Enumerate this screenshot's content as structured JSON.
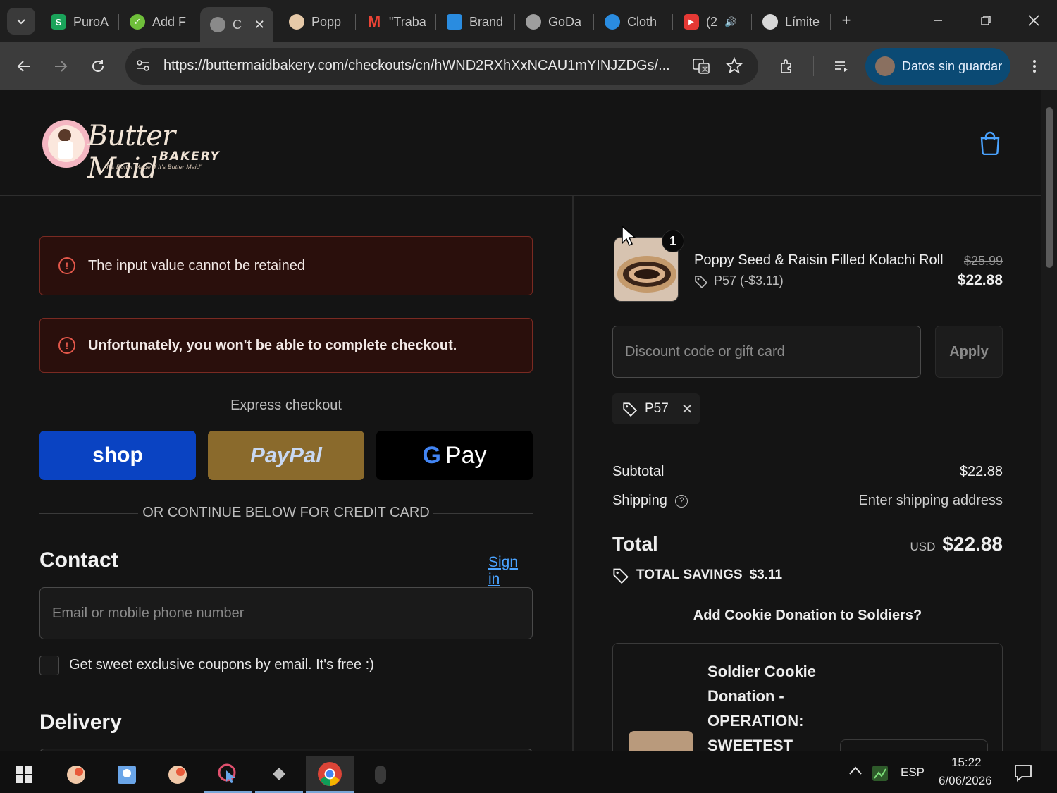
{
  "browser": {
    "tabs": [
      {
        "label": "PuroA",
        "favicon_color": "#1aa35a",
        "favicon_letter": "S"
      },
      {
        "label": "Add F",
        "favicon_color": "#6fbf3a",
        "favicon_letter": "✓"
      },
      {
        "label": "C",
        "favicon_color": "#8a8a8a",
        "favicon_letter": "",
        "active": true
      },
      {
        "label": "Popp",
        "favicon_color": "#e6c9a8",
        "favicon_letter": ""
      },
      {
        "label": "\"Traba",
        "favicon_color": "#ea4335",
        "favicon_letter": "M"
      },
      {
        "label": "Brand",
        "favicon_color": "#2a8ce0",
        "favicon_letter": ""
      },
      {
        "label": "GoDa",
        "favicon_color": "#9e9e9e",
        "favicon_letter": ""
      },
      {
        "label": "Cloth",
        "favicon_color": "#2a8ce0",
        "favicon_letter": ""
      },
      {
        "label": "(2",
        "favicon_color": "#e53935",
        "favicon_letter": "▶"
      },
      {
        "label": "Límite",
        "favicon_color": "#d8d8d8",
        "favicon_letter": ""
      }
    ],
    "url": "https://buttermaidbakery.com/checkouts/cn/hWND2RXhXxNCAU1mYINJZDGs/...",
    "profile_label": "Datos sin guardar"
  },
  "header": {
    "logo_text": "Butter Maid",
    "logo_sub": "BAKERY",
    "logo_tag": "\"It's Butter Made If It's Butter Maid\""
  },
  "errors": [
    "The input value cannot be retained",
    "Unfortunately, you won't be able to complete checkout."
  ],
  "express": {
    "title": "Express checkout",
    "shop_label": "shop",
    "paypal_label": "PayPal",
    "gpay_label": "Pay"
  },
  "or_text": "OR CONTINUE BELOW FOR CREDIT CARD",
  "contact": {
    "heading": "Contact",
    "signin": "Sign in",
    "email_placeholder": "Email or mobile phone number",
    "newsletter_label": "Get sweet exclusive coupons by email. It's free :)"
  },
  "delivery": {
    "heading": "Delivery"
  },
  "summary": {
    "quantity": "1",
    "product_name": "Poppy Seed & Raisin Filled Kolachi Roll",
    "product_discount": "P57 (-$3.11)",
    "price_old": "$25.99",
    "price_new": "$22.88",
    "discount_placeholder": "Discount code or gift card",
    "apply_label": "Apply",
    "code_chip": "P57",
    "subtotal_label": "Subtotal",
    "subtotal_value": "$22.88",
    "shipping_label": "Shipping",
    "shipping_value": "Enter shipping address",
    "total_label": "Total",
    "total_currency": "USD",
    "total_value": "$22.88",
    "savings_label": "TOTAL SAVINGS",
    "savings_value": "$3.11",
    "donation_title": "Add Cookie Donation to Soldiers?",
    "donation_name": "Soldier Cookie Donation - OPERATION: SWEETEST"
  },
  "taskbar": {
    "lang": "ESP",
    "time": "15:22",
    "date": "6/06/2026"
  }
}
